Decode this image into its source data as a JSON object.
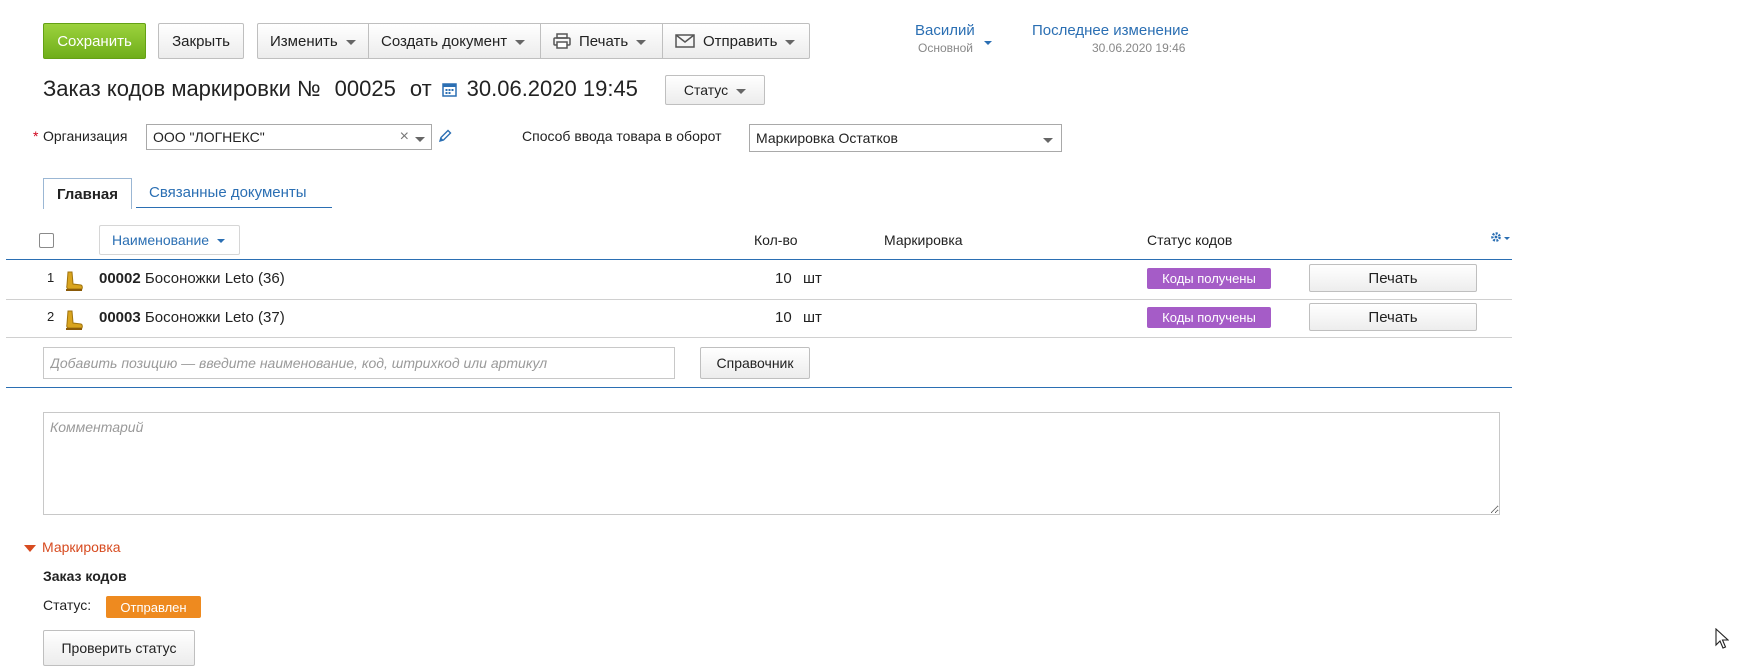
{
  "toolbar": {
    "save_label": "Сохранить",
    "close_label": "Закрыть",
    "edit_label": "Изменить",
    "create_doc_label": "Создать документ",
    "print_label": "Печать",
    "send_label": "Отправить"
  },
  "user": {
    "name": "Василий",
    "role": "Основной"
  },
  "last_change": {
    "label": "Последнее изменение",
    "value": "30.06.2020 19:46"
  },
  "doc": {
    "title": "Заказ кодов маркировки №",
    "number": "00025",
    "from_label": "от",
    "date": "30.06.2020 19:45",
    "status_button": "Статус"
  },
  "form": {
    "required_mark": "*",
    "org_label": "Организация",
    "org_value": "ООО \"ЛОГНЕКС\"",
    "input_method_label": "Способ ввода товара в оборот",
    "input_method_value": "Маркировка Остатков"
  },
  "tabs": [
    {
      "label": "Главная",
      "active": true
    },
    {
      "label": "Связанные документы",
      "active": false
    }
  ],
  "table": {
    "columns": {
      "name": "Наименование",
      "qty": "Кол-во",
      "marking": "Маркировка",
      "status": "Статус кодов"
    },
    "rows": [
      {
        "index": "1",
        "code": "00002",
        "name": "Босоножки Leto (36)",
        "qty": "10",
        "unit": "шт",
        "status": "Коды получены",
        "print": "Печать"
      },
      {
        "index": "2",
        "code": "00003",
        "name": "Босоножки Leto (37)",
        "qty": "10",
        "unit": "шт",
        "status": "Коды получены",
        "print": "Печать"
      }
    ],
    "add_placeholder": "Добавить позицию — введите наименование, код, штрихкод или артикул",
    "catalog_button": "Справочник"
  },
  "comment_placeholder": "Комментарий",
  "marking_section": {
    "title": "Маркировка",
    "order_title": "Заказ кодов",
    "status_label": "Статус:",
    "status_value": "Отправлен",
    "check_button": "Проверить статус"
  },
  "colors": {
    "accent_blue": "#2b6fb3",
    "save_green": "#7bb924",
    "badge_purple": "#a55cc7",
    "badge_orange": "#ee8a1f",
    "section_red": "#d74b20"
  }
}
